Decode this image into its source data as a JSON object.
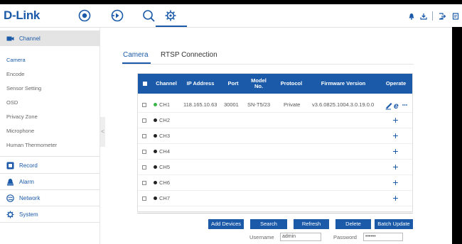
{
  "header": {
    "logo": "D-Link"
  },
  "sidebar": {
    "sections": [
      {
        "label": "Channel",
        "icon": "camera-icon"
      },
      {
        "label": "Record",
        "icon": "record-icon"
      },
      {
        "label": "Alarm",
        "icon": "alarm-icon"
      },
      {
        "label": "Network",
        "icon": "network-icon"
      },
      {
        "label": "System",
        "icon": "system-icon"
      }
    ],
    "channel_items": [
      "Camera",
      "Encode",
      "Sensor Setting",
      "OSD",
      "Privacy Zone",
      "Microphone",
      "Human Thermometer"
    ],
    "collapse_glyph": "<"
  },
  "tabs": [
    "Camera",
    "RTSP Connection"
  ],
  "table": {
    "headers": [
      "Channel",
      "IP Address",
      "Port",
      "Model No.",
      "Protocol",
      "Firmware Version",
      "Operate"
    ],
    "rows": [
      {
        "channel": "CH1",
        "ip": "118.165.10.63",
        "port": "30001",
        "model": "SN-T5/23",
        "protocol": "Private",
        "firmware": "v3.6.0825.1004.3.0.19.0.0",
        "online": true
      },
      {
        "channel": "CH2"
      },
      {
        "channel": "CH3"
      },
      {
        "channel": "CH4"
      },
      {
        "channel": "CH5"
      },
      {
        "channel": "CH6"
      },
      {
        "channel": "CH7"
      }
    ],
    "add_glyph": "+"
  },
  "actions": {
    "add_devices": "Add Devices",
    "search": "Search",
    "refresh": "Refresh",
    "delete": "Delete",
    "batch_update": "Batch Update"
  },
  "credentials": {
    "username_label": "Username",
    "username_value": "admin",
    "password_label": "Password",
    "password_value": "••••••"
  },
  "colors": {
    "accent": "#1a5aa8",
    "online": "#3ab54a"
  }
}
